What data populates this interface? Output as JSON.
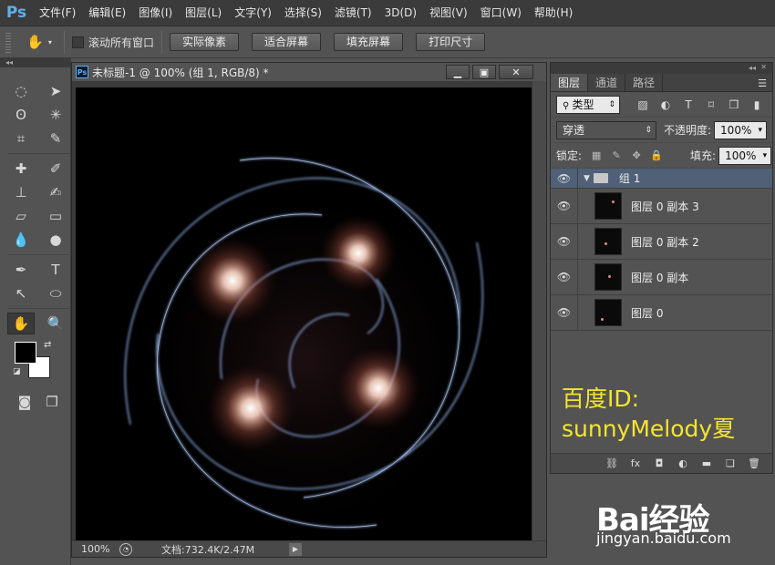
{
  "app": {
    "logo": "Ps"
  },
  "menu": [
    "文件(F)",
    "编辑(E)",
    "图像(I)",
    "图层(L)",
    "文字(Y)",
    "选择(S)",
    "滤镜(T)",
    "3D(D)",
    "视图(V)",
    "窗口(W)",
    "帮助(H)"
  ],
  "options": {
    "scroll_all_label": "滚动所有窗口",
    "buttons": [
      "实际像素",
      "适合屏幕",
      "填充屏幕",
      "打印尺寸"
    ]
  },
  "document": {
    "title": "未标题-1 @ 100% (组 1, RGB/8) *",
    "zoom": "100%",
    "doc_info": "文档:732.4K/2.47M"
  },
  "layers_panel": {
    "tabs": [
      "图层",
      "通道",
      "路径"
    ],
    "filter_type": "类型",
    "blend_mode": "穿透",
    "opacity_label": "不透明度:",
    "opacity_value": "100%",
    "lock_label": "锁定:",
    "fill_label": "填充:",
    "fill_value": "100%",
    "group_name": "组 1",
    "layers": [
      "图层 0 副本 3",
      "图层 0 副本 2",
      "图层 0 副本",
      "图层 0"
    ]
  },
  "watermark": {
    "line1": "百度ID:",
    "line2": "sunnyMelody夏"
  },
  "branding": {
    "logo": "Bai经验",
    "url": "jingyan.baidu.com"
  },
  "colors": {
    "accent": "#5fb0ea",
    "group_highlight": "#4f6077",
    "watermark": "#f5e52f"
  }
}
